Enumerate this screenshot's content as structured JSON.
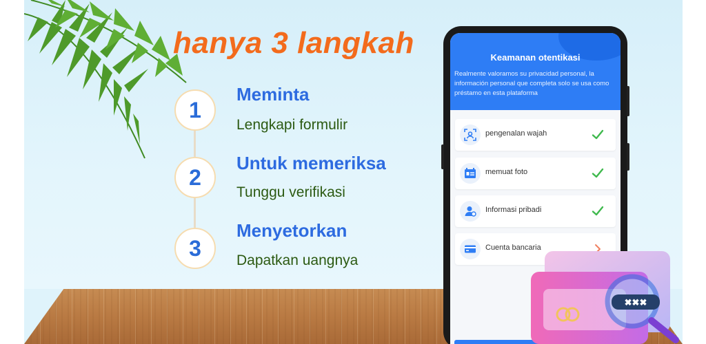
{
  "headline": "hanya 3 langkah",
  "steps": [
    {
      "number": "1",
      "title": "Meminta",
      "subtitle": "Lengkapi formulir"
    },
    {
      "number": "2",
      "title": "Untuk memeriksa",
      "subtitle": "Tunggu verifikasi"
    },
    {
      "number": "3",
      "title": "Menyetorkan",
      "subtitle": "Dapatkan uangnya"
    }
  ],
  "phone": {
    "title": "Keamanan otentikasi",
    "description": "Realmente valoramos su privacidad personal, la información personal que completa solo se usa como préstamo en esta plataforma",
    "items": [
      {
        "label": "pengenalan wajah",
        "icon": "face-scan-icon",
        "status": "checked"
      },
      {
        "label": "memuat foto",
        "icon": "id-card-icon",
        "status": "checked"
      },
      {
        "label": "Informasi pribadi",
        "icon": "person-icon",
        "status": "checked"
      },
      {
        "label": "Cuenta bancaria",
        "icon": "bank-card-icon",
        "status": "pending"
      }
    ]
  },
  "decoration": {
    "card_mask": "✖✖✖"
  },
  "colors": {
    "accent_orange": "#f36b1c",
    "primary_blue": "#2e7df5",
    "step_blue": "#2d6be0",
    "check_green": "#3fb94d",
    "sub_green": "#2c5a12"
  }
}
